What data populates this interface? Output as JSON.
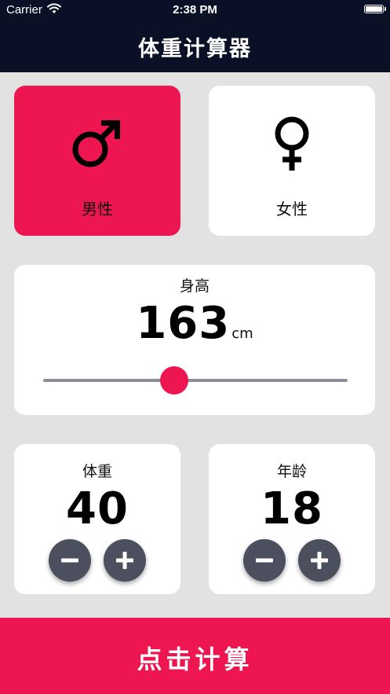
{
  "status_bar": {
    "carrier": "Carrier",
    "time": "2:38 PM"
  },
  "nav": {
    "title": "体重计算器"
  },
  "gender": {
    "male": {
      "label": "男性",
      "selected": true
    },
    "female": {
      "label": "女性",
      "selected": false
    }
  },
  "height": {
    "label": "身高",
    "value": "163",
    "unit": "cm",
    "slider_fraction": 0.43
  },
  "weight": {
    "label": "体重",
    "value": "40"
  },
  "age": {
    "label": "年龄",
    "value": "18"
  },
  "calc_button": {
    "label": "点击计算"
  },
  "colors": {
    "accent": "#ee1651",
    "nav_bg": "#0a1026",
    "card_bg": "#ffffff",
    "page_bg": "#e2e2e2",
    "round_button": "#4c4f5e"
  }
}
